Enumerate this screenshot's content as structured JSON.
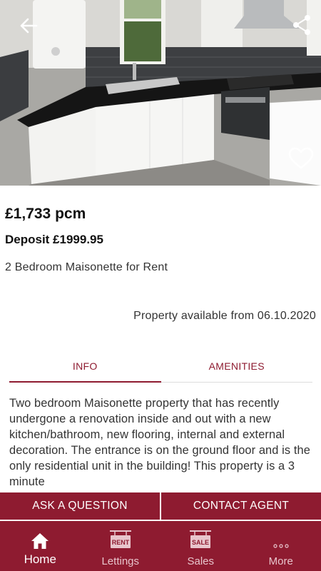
{
  "listing": {
    "price": "£1,733 pcm",
    "deposit": "Deposit £1999.95",
    "property_type": "2 Bedroom Maisonette for Rent",
    "availability": "Property available from 06.10.2020",
    "description": "Two bedroom Maisonette property that has recently undergone a renovation inside and out with a new kitchen/bathroom, new flooring, internal and external decoration. The entrance is on the ground floor and is the only residential unit in the building! This property is a 3 minute"
  },
  "tabs": [
    {
      "label": "INFO",
      "active": true
    },
    {
      "label": "AMENITIES",
      "active": false
    }
  ],
  "actions": {
    "ask_label": "ASK A QUESTION",
    "contact_label": "CONTACT AGENT"
  },
  "nav": [
    {
      "label": "Home",
      "icon": "home-icon",
      "active": true
    },
    {
      "label": "Lettings",
      "icon": "rent-sign-icon",
      "badge": "RENT",
      "active": false
    },
    {
      "label": "Sales",
      "icon": "sale-sign-icon",
      "badge": "SALE",
      "active": false
    },
    {
      "label": "More",
      "icon": "more-dots-icon",
      "active": false
    }
  ],
  "icons": {
    "back": "arrow-left-icon",
    "share": "share-icon",
    "favourite": "heart-outline-icon"
  },
  "colors": {
    "brand": "#8e1b30",
    "brand_text": "#ffffff"
  }
}
